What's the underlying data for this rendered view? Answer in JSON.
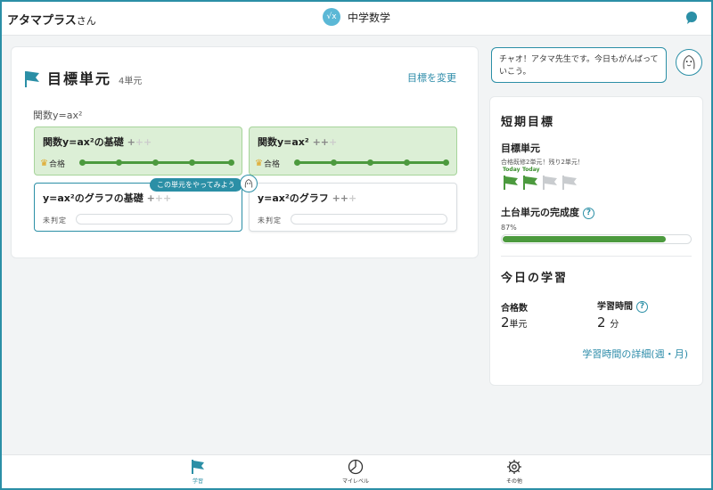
{
  "header": {
    "app_name": "アタマプラス",
    "app_suffix": "さん",
    "subject": "中学数学",
    "subject_icon_text": "√x"
  },
  "goal": {
    "title": "目標単元",
    "count": "4単元",
    "change_link": "目標を変更",
    "section_label": "関数y=ax²"
  },
  "units": [
    {
      "title": "関数y=ax²の基礎 ",
      "plus_on": "+",
      "plus_off": "++",
      "status_label": "合格",
      "state": "passed"
    },
    {
      "title": "関数y=ax² ",
      "plus_on": "++",
      "plus_off": "+",
      "status_label": "合格",
      "state": "passed"
    },
    {
      "title": "y=ax²のグラフの基礎 ",
      "plus_on": "+",
      "plus_off": "++",
      "status_label": "未判定",
      "state": "active"
    },
    {
      "title": "y=ax²のグラフ ",
      "plus_on": "++",
      "plus_off": "+",
      "status_label": "未判定",
      "state": "pending"
    }
  ],
  "try_badge": "この単元をやってみよう",
  "speech": "チャオ！アタマ先生です。今日もがんばっていこう。",
  "short_goal": {
    "title": "短期目標",
    "target_label": "目標単元",
    "target_note": "合格既修2単元！残り2単元！",
    "today_labels": [
      "Today",
      "Today"
    ],
    "foundation_label": "土台単元の完成度",
    "foundation_pct_text": "87%",
    "foundation_pct": 87
  },
  "today": {
    "title": "今日の学習",
    "passed_label": "合格数",
    "passed_value": "2",
    "passed_unit": "単元",
    "time_label": "学習時間",
    "time_value": "2",
    "time_unit": "分",
    "detail_link": "学習時間の詳細(週・月)"
  },
  "help_glyph": "?",
  "nav": [
    {
      "label": "学習",
      "icon": "flag-icon",
      "active": true
    },
    {
      "label": "マイレベル",
      "icon": "pie-icon",
      "active": false
    },
    {
      "label": "その他",
      "icon": "gear-icon",
      "active": false
    }
  ],
  "colors": {
    "accent": "#2b8fa6",
    "pass_green": "#4c9a3e",
    "pass_bg": "#dcefd6"
  }
}
